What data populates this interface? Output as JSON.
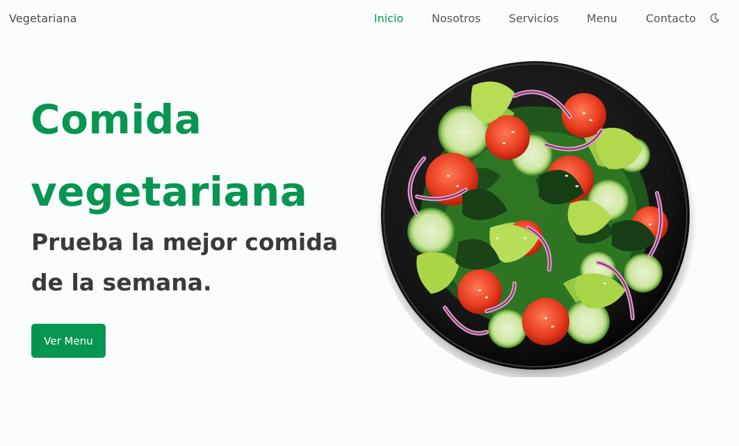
{
  "header": {
    "brand": "Vegetariana",
    "nav": [
      {
        "label": "Inicio",
        "active": true
      },
      {
        "label": "Nosotros",
        "active": false
      },
      {
        "label": "Servicios",
        "active": false
      },
      {
        "label": "Menu",
        "active": false
      },
      {
        "label": "Contacto",
        "active": false
      }
    ],
    "theme_toggle_icon": "moon-icon"
  },
  "hero": {
    "title_line1": "Comida",
    "title_line2": "vegetariana",
    "subtitle_line1": "Prueba la mejor comida",
    "subtitle_line2": "de la semana.",
    "cta_label": "Ver Menu",
    "image_icon": "salad-bowl-image"
  },
  "colors": {
    "accent": "#079652",
    "text_dark": "#3a3a3a",
    "nav_text": "#555555",
    "background": "#fbfdfc"
  }
}
